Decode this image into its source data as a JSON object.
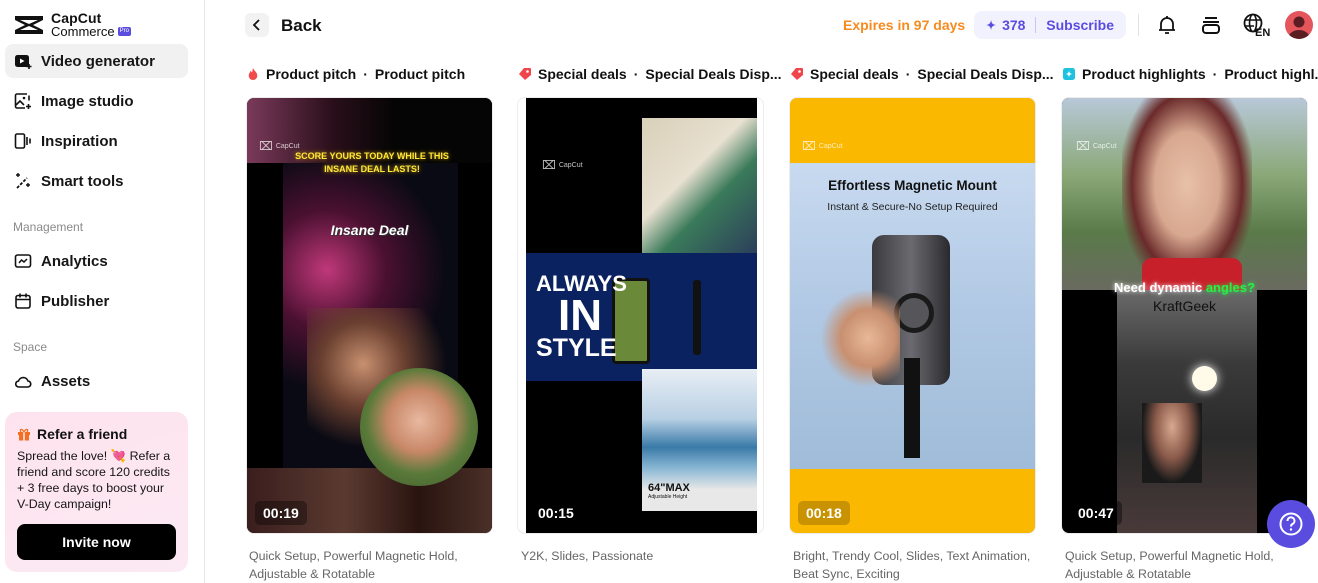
{
  "brand": {
    "name_line1": "CapCut",
    "name_line2": "Commerce",
    "badge": "Pro"
  },
  "sidebar": {
    "items": [
      {
        "label": "Video generator",
        "icon": "video-generator-icon",
        "active": true
      },
      {
        "label": "Image studio",
        "icon": "image-studio-icon"
      },
      {
        "label": "Inspiration",
        "icon": "inspiration-icon"
      },
      {
        "label": "Smart tools",
        "icon": "magic-wand-icon"
      }
    ],
    "management_label": "Management",
    "management_items": [
      {
        "label": "Analytics",
        "icon": "analytics-icon"
      },
      {
        "label": "Publisher",
        "icon": "calendar-icon"
      }
    ],
    "space_label": "Space",
    "space_items": [
      {
        "label": "Assets",
        "icon": "cloud-icon"
      }
    ],
    "refer": {
      "title": "Refer a friend",
      "body_part1": "Spread the love! ",
      "emoji": "💘",
      "body_part2": " Refer a friend and score 120 credits + 3 free days to boost your V-Day campaign!",
      "button": "Invite now"
    }
  },
  "header": {
    "back_label": "Back",
    "expires": "Expires in 97 days",
    "credits": "378",
    "subscribe": "Subscribe",
    "language": "EN"
  },
  "cards": [
    {
      "category": "Product pitch",
      "name": "Product pitch",
      "icon": "fire-icon",
      "duration": "00:19",
      "tags": "Quick Setup, Powerful Magnetic Hold, Adjustable & Rotatable",
      "overlay_top": "SCORE YOURS TODAY WHILE THIS INSANE DEAL LASTS!",
      "overlay_mid": "Insane Deal"
    },
    {
      "category": "Special deals",
      "name": "Special Deals Disp...",
      "icon": "tag-icon",
      "duration": "00:15",
      "tags": "Y2K, Slides, Passionate",
      "overlay_line1": "ALWAYS",
      "overlay_line2": "IN",
      "overlay_line3": "STYLE",
      "overlay_max": "64\"MAX",
      "overlay_sub": "Adjustable Height"
    },
    {
      "category": "Special deals",
      "name": "Special Deals Disp...",
      "icon": "tag-icon",
      "duration": "00:18",
      "tags": "Bright, Trendy Cool, Slides, Text Animation, Beat Sync, Exciting",
      "overlay_title": "Effortless Magnetic Mount",
      "overlay_sub": "Instant & Secure-No Setup Required"
    },
    {
      "category": "Product highlights",
      "name": "Product highl...",
      "icon": "sparkle-box-icon",
      "duration": "00:47",
      "tags": "Quick Setup, Powerful Magnetic Hold, Adjustable & Rotatable",
      "overlay_white": "Need dynamic ",
      "overlay_green": "angles?",
      "overlay_brand": "KraftGeek"
    }
  ],
  "watermark": {
    "line1": "CapCut",
    "line2": "Commerce"
  },
  "colors": {
    "accent": "#5b4ce0",
    "expires": "#f68b1f",
    "tag_red": "#f0454b",
    "fire_red": "#f04b4b",
    "highlight_cyan": "#1ec2e0"
  }
}
